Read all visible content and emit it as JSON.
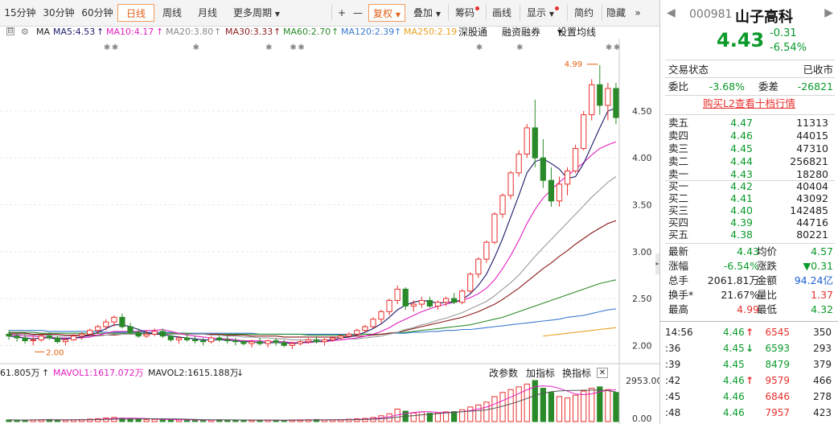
{
  "toolbar": {
    "p15": "15分钟",
    "p30": "30分钟",
    "p60": "60分钟",
    "daily": "日线",
    "weekly": "周线",
    "monthly": "月线",
    "more_periods": "更多周期",
    "plus": "+",
    "minus": "—",
    "fuquan": "复权",
    "overlay": "叠加",
    "chips": "筹码",
    "draw": "画线",
    "display": "显示",
    "simple": "简约",
    "hide": "隐藏",
    "more": "»"
  },
  "ma_legend": {
    "ma": "MA",
    "ma5": "MA5:4.53",
    "ma10": "MA10:4.17",
    "ma20": "MA20:3.80",
    "ma30": "MA30:3.33",
    "ma60": "MA60:2.70",
    "ma120": "MA120:2.39",
    "ma250": "MA250:2.19",
    "shenggang": "深股通",
    "margin": "融资融券",
    "settings": "设置均线"
  },
  "colors": {
    "up": "#e8302c",
    "down": "#2a8a2a",
    "ma5": "#1a1a6a",
    "ma10": "#e020c0",
    "ma20": "#9a9a9a",
    "ma30": "#8a1a1a",
    "ma60": "#2a8a2a",
    "ma120": "#3a7ad0",
    "ma250": "#e8a020"
  },
  "price_axis": [
    "4.50",
    "4.00",
    "3.50",
    "3.00",
    "2.50",
    "2.00"
  ],
  "high_mark": "4.99",
  "low_mark": "2.00",
  "volume": {
    "label_a": "61.805万",
    "vol_arrow": "↑",
    "mavol1": "MAVOL1:1617.072万",
    "mavol2": "MAVOL2:1615.188万",
    "down": "↓",
    "change_param": "改参数",
    "add_indicator": "加指标",
    "switch_indicator": "换指标",
    "close": "✕",
    "axis_top": "2953.00",
    "axis_bottom": "0.00"
  },
  "chart_data": {
    "type": "candlestick",
    "ohlc": [
      [
        2.12,
        2.16,
        2.06,
        2.1
      ],
      [
        2.1,
        2.14,
        2.04,
        2.08
      ],
      [
        2.08,
        2.12,
        2.02,
        2.05
      ],
      [
        2.05,
        2.1,
        2.0,
        2.06
      ],
      [
        2.06,
        2.12,
        2.04,
        2.1
      ],
      [
        2.1,
        2.14,
        2.06,
        2.08
      ],
      [
        2.08,
        2.1,
        2.02,
        2.04
      ],
      [
        2.04,
        2.08,
        2.0,
        2.06
      ],
      [
        2.06,
        2.12,
        2.05,
        2.1
      ],
      [
        2.1,
        2.14,
        2.06,
        2.12
      ],
      [
        2.12,
        2.18,
        2.1,
        2.16
      ],
      [
        2.16,
        2.22,
        2.12,
        2.2
      ],
      [
        2.2,
        2.28,
        2.16,
        2.25
      ],
      [
        2.25,
        2.32,
        2.2,
        2.3
      ],
      [
        2.3,
        2.34,
        2.18,
        2.2
      ],
      [
        2.2,
        2.24,
        2.12,
        2.14
      ],
      [
        2.14,
        2.18,
        2.08,
        2.1
      ],
      [
        2.1,
        2.16,
        2.08,
        2.12
      ],
      [
        2.12,
        2.18,
        2.1,
        2.15
      ],
      [
        2.15,
        2.18,
        2.08,
        2.1
      ],
      [
        2.1,
        2.12,
        2.04,
        2.06
      ],
      [
        2.06,
        2.1,
        2.02,
        2.08
      ],
      [
        2.08,
        2.12,
        2.04,
        2.06
      ],
      [
        2.06,
        2.1,
        2.02,
        2.05
      ],
      [
        2.05,
        2.08,
        2.0,
        2.04
      ],
      [
        2.04,
        2.1,
        2.02,
        2.08
      ],
      [
        2.08,
        2.12,
        2.04,
        2.06
      ],
      [
        2.06,
        2.1,
        2.02,
        2.05
      ],
      [
        2.05,
        2.08,
        2.0,
        2.04
      ],
      [
        2.04,
        2.06,
        2.0,
        2.02
      ],
      [
        2.02,
        2.06,
        1.98,
        2.04
      ],
      [
        2.04,
        2.08,
        2.0,
        2.02
      ],
      [
        2.02,
        2.06,
        1.98,
        2.05
      ],
      [
        2.05,
        2.08,
        2.0,
        2.03
      ],
      [
        2.03,
        2.06,
        1.98,
        2.0
      ],
      [
        2.0,
        2.04,
        1.96,
        2.02
      ],
      [
        2.02,
        2.06,
        2.0,
        2.04
      ],
      [
        2.04,
        2.08,
        2.02,
        2.06
      ],
      [
        2.06,
        2.1,
        2.02,
        2.04
      ],
      [
        2.04,
        2.08,
        2.0,
        2.06
      ],
      [
        2.06,
        2.1,
        2.04,
        2.08
      ],
      [
        2.08,
        2.12,
        2.06,
        2.1
      ],
      [
        2.1,
        2.14,
        2.08,
        2.12
      ],
      [
        2.12,
        2.18,
        2.1,
        2.16
      ],
      [
        2.16,
        2.22,
        2.14,
        2.2
      ],
      [
        2.2,
        2.3,
        2.18,
        2.28
      ],
      [
        2.28,
        2.38,
        2.24,
        2.36
      ],
      [
        2.36,
        2.5,
        2.32,
        2.48
      ],
      [
        2.48,
        2.64,
        2.44,
        2.6
      ],
      [
        2.6,
        2.62,
        2.38,
        2.42
      ],
      [
        2.42,
        2.48,
        2.36,
        2.44
      ],
      [
        2.44,
        2.52,
        2.4,
        2.48
      ],
      [
        2.48,
        2.52,
        2.4,
        2.42
      ],
      [
        2.42,
        2.48,
        2.38,
        2.46
      ],
      [
        2.46,
        2.52,
        2.42,
        2.5
      ],
      [
        2.5,
        2.56,
        2.44,
        2.46
      ],
      [
        2.46,
        2.6,
        2.44,
        2.58
      ],
      [
        2.58,
        2.78,
        2.56,
        2.76
      ],
      [
        2.76,
        2.94,
        2.72,
        2.92
      ],
      [
        2.92,
        3.12,
        2.88,
        3.1
      ],
      [
        3.1,
        3.42,
        3.08,
        3.4
      ],
      [
        3.4,
        3.62,
        3.36,
        3.6
      ],
      [
        3.6,
        3.86,
        3.56,
        3.84
      ],
      [
        3.84,
        4.08,
        3.8,
        4.04
      ],
      [
        4.04,
        4.36,
        4.0,
        4.32
      ],
      [
        4.32,
        4.62,
        3.9,
        4.0
      ],
      [
        4.0,
        4.2,
        3.68,
        3.76
      ],
      [
        3.76,
        3.9,
        3.48,
        3.54
      ],
      [
        3.54,
        3.8,
        3.48,
        3.72
      ],
      [
        3.72,
        3.9,
        3.6,
        3.86
      ],
      [
        3.86,
        4.14,
        3.84,
        4.1
      ],
      [
        4.1,
        4.5,
        4.08,
        4.46
      ],
      [
        4.46,
        4.84,
        4.4,
        4.78
      ],
      [
        4.78,
        4.99,
        4.46,
        4.56
      ],
      [
        4.56,
        4.8,
        4.4,
        4.74
      ],
      [
        4.74,
        4.8,
        4.36,
        4.43
      ]
    ],
    "ma5": [
      2.1,
      2.09,
      2.08,
      2.07,
      2.08,
      2.08,
      2.07,
      2.07,
      2.08,
      2.09,
      2.11,
      2.14,
      2.18,
      2.22,
      2.22,
      2.2,
      2.17,
      2.14,
      2.12,
      2.12,
      2.1,
      2.09,
      2.08,
      2.07,
      2.06,
      2.06,
      2.06,
      2.06,
      2.05,
      2.04,
      2.04,
      2.03,
      2.03,
      2.03,
      2.03,
      2.02,
      2.03,
      2.04,
      2.04,
      2.05,
      2.06,
      2.08,
      2.09,
      2.11,
      2.14,
      2.18,
      2.23,
      2.3,
      2.38,
      2.43,
      2.46,
      2.48,
      2.47,
      2.45,
      2.46,
      2.46,
      2.49,
      2.55,
      2.64,
      2.76,
      2.94,
      3.14,
      3.37,
      3.6,
      3.84,
      3.96,
      3.99,
      3.94,
      3.88,
      3.78,
      3.8,
      3.94,
      4.13,
      4.32,
      4.5,
      4.53
    ],
    "ma10": [
      2.11,
      2.11,
      2.1,
      2.1,
      2.09,
      2.09,
      2.08,
      2.08,
      2.08,
      2.08,
      2.09,
      2.11,
      2.13,
      2.15,
      2.15,
      2.15,
      2.15,
      2.16,
      2.16,
      2.17,
      2.15,
      2.13,
      2.11,
      2.1,
      2.09,
      2.08,
      2.07,
      2.07,
      2.06,
      2.05,
      2.05,
      2.05,
      2.04,
      2.04,
      2.04,
      2.03,
      2.03,
      2.03,
      2.04,
      2.04,
      2.05,
      2.06,
      2.07,
      2.08,
      2.1,
      2.12,
      2.15,
      2.19,
      2.24,
      2.28,
      2.32,
      2.36,
      2.39,
      2.42,
      2.44,
      2.46,
      2.48,
      2.51,
      2.55,
      2.61,
      2.7,
      2.82,
      2.96,
      3.12,
      3.3,
      3.45,
      3.57,
      3.66,
      3.74,
      3.81,
      3.88,
      3.95,
      4.03,
      4.1,
      4.14,
      4.17
    ],
    "ma20": [
      2.12,
      2.12,
      2.12,
      2.11,
      2.11,
      2.11,
      2.1,
      2.1,
      2.1,
      2.1,
      2.1,
      2.1,
      2.11,
      2.12,
      2.12,
      2.12,
      2.12,
      2.12,
      2.12,
      2.12,
      2.12,
      2.12,
      2.12,
      2.12,
      2.12,
      2.11,
      2.11,
      2.1,
      2.1,
      2.09,
      2.09,
      2.08,
      2.08,
      2.07,
      2.07,
      2.06,
      2.06,
      2.06,
      2.06,
      2.06,
      2.06,
      2.06,
      2.07,
      2.07,
      2.08,
      2.09,
      2.1,
      2.12,
      2.14,
      2.17,
      2.19,
      2.22,
      2.24,
      2.27,
      2.29,
      2.32,
      2.35,
      2.39,
      2.43,
      2.47,
      2.53,
      2.6,
      2.67,
      2.75,
      2.85,
      2.95,
      3.04,
      3.13,
      3.22,
      3.31,
      3.4,
      3.49,
      3.58,
      3.66,
      3.74,
      3.8
    ],
    "ma30": [
      2.13,
      2.13,
      2.13,
      2.12,
      2.12,
      2.12,
      2.12,
      2.11,
      2.11,
      2.11,
      2.11,
      2.11,
      2.11,
      2.11,
      2.12,
      2.12,
      2.12,
      2.12,
      2.12,
      2.12,
      2.12,
      2.12,
      2.12,
      2.12,
      2.12,
      2.12,
      2.12,
      2.11,
      2.11,
      2.11,
      2.1,
      2.1,
      2.1,
      2.1,
      2.09,
      2.09,
      2.09,
      2.09,
      2.09,
      2.09,
      2.09,
      2.09,
      2.1,
      2.1,
      2.1,
      2.11,
      2.12,
      2.13,
      2.14,
      2.16,
      2.18,
      2.2,
      2.22,
      2.24,
      2.26,
      2.28,
      2.3,
      2.33,
      2.36,
      2.4,
      2.44,
      2.49,
      2.55,
      2.61,
      2.68,
      2.75,
      2.82,
      2.88,
      2.95,
      3.01,
      3.08,
      3.14,
      3.2,
      3.25,
      3.3,
      3.33
    ],
    "ma60": [
      2.14,
      2.14,
      2.14,
      2.14,
      2.13,
      2.13,
      2.13,
      2.13,
      2.13,
      2.13,
      2.13,
      2.13,
      2.13,
      2.13,
      2.13,
      2.13,
      2.13,
      2.13,
      2.13,
      2.13,
      2.13,
      2.13,
      2.13,
      2.12,
      2.12,
      2.12,
      2.12,
      2.12,
      2.12,
      2.12,
      2.12,
      2.12,
      2.12,
      2.12,
      2.12,
      2.12,
      2.12,
      2.11,
      2.11,
      2.11,
      2.11,
      2.11,
      2.11,
      2.12,
      2.12,
      2.12,
      2.12,
      2.13,
      2.14,
      2.14,
      2.15,
      2.16,
      2.17,
      2.18,
      2.19,
      2.2,
      2.21,
      2.22,
      2.24,
      2.26,
      2.28,
      2.3,
      2.33,
      2.36,
      2.39,
      2.42,
      2.45,
      2.48,
      2.51,
      2.54,
      2.57,
      2.6,
      2.63,
      2.66,
      2.68,
      2.7
    ],
    "ma120": [
      2.16,
      2.16,
      2.16,
      2.16,
      2.16,
      2.15,
      2.15,
      2.15,
      2.15,
      2.15,
      2.15,
      2.15,
      2.14,
      2.14,
      2.14,
      2.14,
      2.14,
      2.14,
      2.14,
      2.14,
      2.14,
      2.13,
      2.13,
      2.13,
      2.13,
      2.13,
      2.13,
      2.13,
      2.13,
      2.13,
      2.13,
      2.12,
      2.12,
      2.12,
      2.12,
      2.12,
      2.12,
      2.12,
      2.12,
      2.12,
      2.12,
      2.12,
      2.12,
      2.12,
      2.12,
      2.12,
      2.12,
      2.13,
      2.13,
      2.13,
      2.14,
      2.14,
      2.15,
      2.15,
      2.16,
      2.16,
      2.17,
      2.17,
      2.18,
      2.19,
      2.2,
      2.21,
      2.22,
      2.23,
      2.24,
      2.25,
      2.26,
      2.27,
      2.28,
      2.3,
      2.31,
      2.32,
      2.34,
      2.36,
      2.38,
      2.39
    ],
    "ma250": [
      null,
      null,
      null,
      null,
      null,
      null,
      null,
      null,
      null,
      null,
      null,
      null,
      null,
      null,
      null,
      null,
      null,
      null,
      null,
      null,
      null,
      null,
      null,
      null,
      null,
      null,
      null,
      null,
      null,
      null,
      null,
      null,
      null,
      null,
      null,
      null,
      null,
      null,
      null,
      null,
      null,
      null,
      null,
      null,
      null,
      null,
      null,
      null,
      null,
      null,
      null,
      null,
      null,
      null,
      null,
      null,
      null,
      null,
      null,
      null,
      null,
      null,
      null,
      null,
      null,
      null,
      2.1,
      2.11,
      2.12,
      2.13,
      2.14,
      2.15,
      2.16,
      2.17,
      2.18,
      2.19
    ],
    "volume": [
      120,
      110,
      100,
      130,
      140,
      150,
      120,
      110,
      130,
      150,
      180,
      210,
      260,
      300,
      250,
      200,
      170,
      150,
      160,
      140,
      130,
      120,
      110,
      120,
      100,
      110,
      130,
      120,
      110,
      100,
      90,
      100,
      110,
      100,
      90,
      120,
      130,
      140,
      150,
      120,
      130,
      150,
      170,
      200,
      230,
      300,
      420,
      560,
      900,
      750,
      620,
      700,
      600,
      640,
      700,
      720,
      850,
      1050,
      1200,
      1400,
      1800,
      2100,
      2300,
      2500,
      2700,
      2953,
      2400,
      2100,
      1800,
      1700,
      1900,
      2200,
      2400,
      2500,
      2300,
      2100
    ],
    "ylim": [
      1.84,
      5.1
    ]
  },
  "quote": {
    "code": "000981",
    "name": "山子高科",
    "price": "4.43",
    "change": "-0.31",
    "change_pct": "-6.54%",
    "status_label": "交易状态",
    "status_value": "已收市",
    "weibi_label": "委比",
    "weibi": "-3.68%",
    "weicha_label": "委差",
    "weicha": "-26821",
    "l2_link": "购买L2查看十档行情",
    "asks": [
      {
        "label": "卖五",
        "price": "4.47",
        "vol": "11313"
      },
      {
        "label": "卖四",
        "price": "4.46",
        "vol": "44015"
      },
      {
        "label": "卖三",
        "price": "4.45",
        "vol": "47310"
      },
      {
        "label": "卖二",
        "price": "4.44",
        "vol": "256821"
      },
      {
        "label": "卖一",
        "price": "4.43",
        "vol": "18280"
      }
    ],
    "bids": [
      {
        "label": "买一",
        "price": "4.42",
        "vol": "40404"
      },
      {
        "label": "买二",
        "price": "4.41",
        "vol": "43092"
      },
      {
        "label": "买三",
        "price": "4.40",
        "vol": "142485"
      },
      {
        "label": "买四",
        "price": "4.39",
        "vol": "44716"
      },
      {
        "label": "买五",
        "price": "4.38",
        "vol": "80221"
      }
    ],
    "stats": [
      {
        "l1": "最新",
        "v1": "4.43",
        "c1": "green",
        "l2": "均价",
        "v2": "4.57",
        "c2": "green"
      },
      {
        "l1": "涨幅",
        "v1": "-6.54%",
        "c1": "green",
        "l2": "涨跌",
        "v2": "▼0.31",
        "c2": "green"
      },
      {
        "l1": "总手",
        "v1": "2061.81万",
        "c1": "dk",
        "l2": "金额",
        "v2": "94.24亿",
        "c2": "blue"
      },
      {
        "l1": "换手*",
        "v1": "21.67%",
        "c1": "dk",
        "l2": "量比",
        "v2": "1.37",
        "c2": "red"
      },
      {
        "l1": "最高",
        "v1": "4.99",
        "c1": "red",
        "l2": "最低",
        "v2": "4.32",
        "c2": "green"
      }
    ],
    "ticks": [
      {
        "time": "14:56",
        "price": "4.46",
        "arrow": "↑",
        "vol": "6545",
        "num": "350",
        "ac": "red",
        "vc": "red"
      },
      {
        "time": ":36",
        "price": "4.45",
        "arrow": "↓",
        "vol": "6593",
        "num": "293",
        "ac": "green",
        "vc": "green"
      },
      {
        "time": ":39",
        "price": "4.45",
        "arrow": "",
        "vol": "8479",
        "num": "379",
        "ac": "",
        "vc": "green"
      },
      {
        "time": ":42",
        "price": "4.46",
        "arrow": "↑",
        "vol": "9579",
        "num": "466",
        "ac": "red",
        "vc": "red"
      },
      {
        "time": ":45",
        "price": "4.46",
        "arrow": "",
        "vol": "6846",
        "num": "278",
        "ac": "",
        "vc": "red"
      },
      {
        "time": ":48",
        "price": "4.46",
        "arrow": "",
        "vol": "7957",
        "num": "423",
        "ac": "",
        "vc": "red"
      }
    ]
  }
}
